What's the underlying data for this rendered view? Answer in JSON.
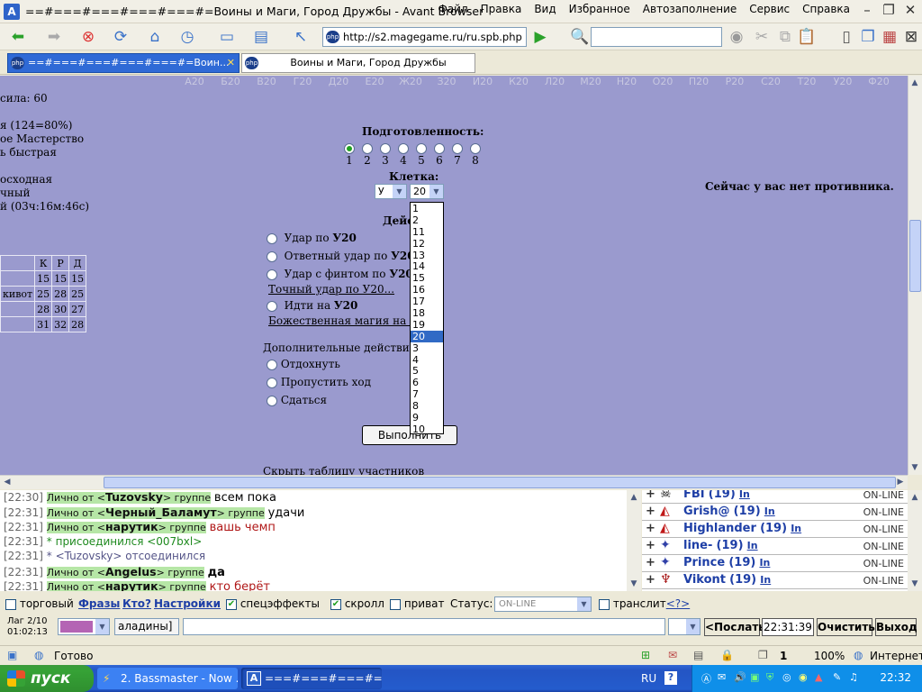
{
  "window": {
    "title": "==#===#===#===#===#=Воины и Маги, Город Дружбы - Avant Browser",
    "menu": [
      "Файл",
      "Правка",
      "Вид",
      "Избранное",
      "Автозаполнение",
      "Сервис",
      "Справка"
    ]
  },
  "toolbar": {
    "address": "http://s2.magegame.ru/ru.spb.php",
    "search_placeholder": ""
  },
  "tabs": [
    {
      "label": "==#===#===#===#===#=Воин...",
      "active": true
    },
    {
      "label": "Воины и Маги, Город Дружбы",
      "active": false
    }
  ],
  "page": {
    "grid_cells": [
      "А20",
      "Б20",
      "В20",
      "Г20",
      "Д20",
      "Е20",
      "Ж20",
      "З20",
      "И20",
      "К20",
      "Л20",
      "М20",
      "Н20",
      "О20",
      "П20",
      "Р20",
      "С20",
      "Т20",
      "У20",
      "Ф20"
    ],
    "left_lines": {
      "strength": "сила: 60",
      "health": "я (124=80%)",
      "mastery": "ое Мастерство",
      "speed": "ь быстрая",
      "state1": "осходная",
      "state2": "чный",
      "timer": "й (03ч:16м:46с)"
    },
    "stat_table": {
      "headers": [
        "К",
        "Р",
        "Д"
      ],
      "rows": [
        {
          "label": "",
          "values": [
            "15",
            "15",
            "15"
          ]
        },
        {
          "label": "кивот",
          "values": [
            "25",
            "28",
            "25"
          ]
        },
        {
          "label": "",
          "values": [
            "28",
            "30",
            "27"
          ]
        },
        {
          "label": "",
          "values": [
            "31",
            "32",
            "28"
          ]
        }
      ]
    },
    "readiness_label": "Подготовленность:",
    "readiness_options": [
      "1",
      "2",
      "3",
      "4",
      "5",
      "6",
      "7",
      "8"
    ],
    "readiness_selected": "1",
    "cell_label": "Клетка:",
    "cell_letter": "У",
    "cell_number": "20",
    "cell_number_options": [
      "1",
      "2",
      "11",
      "12",
      "13",
      "14",
      "15",
      "16",
      "17",
      "18",
      "19",
      "20",
      "3",
      "4",
      "5",
      "6",
      "7",
      "8",
      "9",
      "10"
    ],
    "actions_heading": "Дейс",
    "actions": {
      "strike": "Удар по ",
      "counter": "Ответный удар по ",
      "feint": "Удар с финтом по ",
      "precise": "Точный удар по У20...",
      "move": "Идти на ",
      "divine": "Божественная магия на У20",
      "target": "У20"
    },
    "extra_label": "Дополнительные действия:",
    "extra_actions": [
      "Отдохнуть",
      "Пропустить ход",
      "Сдаться"
    ],
    "execute_button": "Выполнить",
    "no_opponent": "Сейчас у вас нет противника.",
    "hide_table": "Скрыть таблицу участников"
  },
  "chat": [
    {
      "time": "[22:30]",
      "kind": "private",
      "prefix": "Лично от <",
      "nick": "Tuzovsky",
      "suffix": "> группе",
      "text": "всем пока",
      "text_color": "#000000"
    },
    {
      "time": "[22:31]",
      "kind": "private",
      "prefix": "Лично от <",
      "nick": "Черный_Баламут",
      "suffix": "> группе",
      "text": "удачи",
      "text_color": "#000000"
    },
    {
      "time": "[22:31]",
      "kind": "private",
      "prefix": "Лично от <",
      "nick": "нарутик",
      "suffix": "> группе",
      "text": "вашь чемп",
      "text_color": "#b01818"
    },
    {
      "time": "[22:31]",
      "kind": "system",
      "text": "* присоединился <007bxl>",
      "text_color": "#1f8a1f"
    },
    {
      "time": "[22:31]",
      "kind": "system",
      "text": "* <Tuzovsky> отсоединился",
      "text_color": "#555588"
    },
    {
      "time": "[22:31]",
      "kind": "private",
      "prefix": "Лично от <",
      "nick": "Angelus",
      "suffix": "> группе",
      "text": "да",
      "text_color": "#000000"
    },
    {
      "time": "[22:31]",
      "kind": "private",
      "prefix": "Лично от <",
      "nick": "нарутик",
      "suffix": "> группе",
      "text": "кто берёт",
      "text_color": "#b01818"
    }
  ],
  "users": [
    {
      "name": "FBI",
      "level": "(19)",
      "info": "In",
      "status": "ON-LINE",
      "icon": "skull-icon"
    },
    {
      "name": "Grish@",
      "level": "(19)",
      "info": "In",
      "status": "ON-LINE",
      "icon": "bird-icon"
    },
    {
      "name": "Highlander",
      "level": "(19)",
      "info": "In",
      "status": "ON-LINE",
      "icon": "bird-icon"
    },
    {
      "name": "line-",
      "level": "(19)",
      "info": "In",
      "status": "ON-LINE",
      "icon": "dragon-icon"
    },
    {
      "name": "Prince",
      "level": "(19)",
      "info": "In",
      "status": "ON-LINE",
      "icon": "dragon-icon"
    },
    {
      "name": "Vikont",
      "level": "(19)",
      "info": "In",
      "status": "ON-LINE",
      "icon": "demon-icon"
    }
  ],
  "controls": {
    "trade": "торговый",
    "phrases": "Фразы",
    "who": "Кто?",
    "settings": "Настройки",
    "effects": "спецэффекты",
    "scroll": "скролл",
    "private": "приват",
    "status_label": "Статус:",
    "status_value": "ON-LINE",
    "translit": "транслит",
    "translit_help": "<?>",
    "lag": "Лаг 2/10",
    "uptime": "01:02:13",
    "channel": "аладины]",
    "send": "<Послать",
    "time": "22:31:39",
    "clear": "Очистить",
    "exit": "Выход"
  },
  "statusbar": {
    "text": "Готово",
    "page_count": "1",
    "zoom": "100%",
    "zone": "Интернет"
  },
  "taskbar": {
    "start": "пуск",
    "tasks": [
      "2. Bassmaster - Now ...",
      "===#===#===#=..."
    ],
    "lang": "RU",
    "clock": "22:32"
  }
}
